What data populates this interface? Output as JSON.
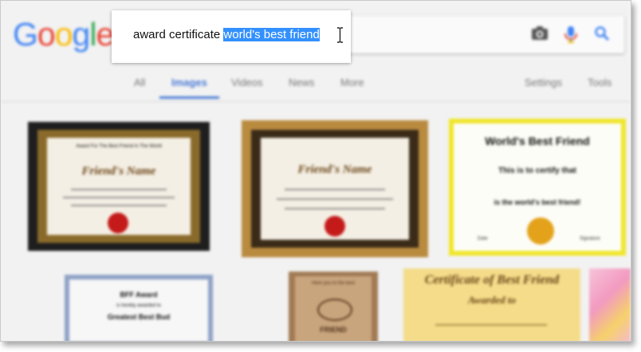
{
  "logo": {
    "letters": [
      "G",
      "o",
      "o",
      "g",
      "l",
      "e"
    ],
    "colors": [
      "#4285f4",
      "#ea4335",
      "#fbbc05",
      "#4285f4",
      "#34a853",
      "#ea4335"
    ]
  },
  "search": {
    "query_plain": "award certificate ",
    "query_selected": "world's best friend"
  },
  "tabs": {
    "all": "All",
    "images": "Images",
    "videos": "Videos",
    "news": "News",
    "more": "More",
    "settings": "Settings",
    "tools": "Tools"
  },
  "results": {
    "c1_title": "Award For The Best Friend In The World",
    "c1_name": "Friend's Name",
    "c2_name": "Friend's Name",
    "c3_title": "World's Best Friend",
    "c3_line1": "This is to certify that",
    "c3_line2": "is the world's best friend!",
    "c3_left": "Date",
    "c3_right": "Signature",
    "c4_title": "BFF Award",
    "c4_line1": "is hereby awarded to",
    "c4_name": "Greatest Best Bud",
    "c5_head": "Here you to the best",
    "c5_word": "FRIEND",
    "c6_title": "Certificate of Best Friend",
    "c6_sub": "Awarded to"
  },
  "colors": {
    "accent": "#4a7bd6",
    "selection": "#3390ff",
    "seal_red": "#c41a1a",
    "seal_gold": "#e3a21a",
    "yellow_border": "#f0e62a"
  }
}
